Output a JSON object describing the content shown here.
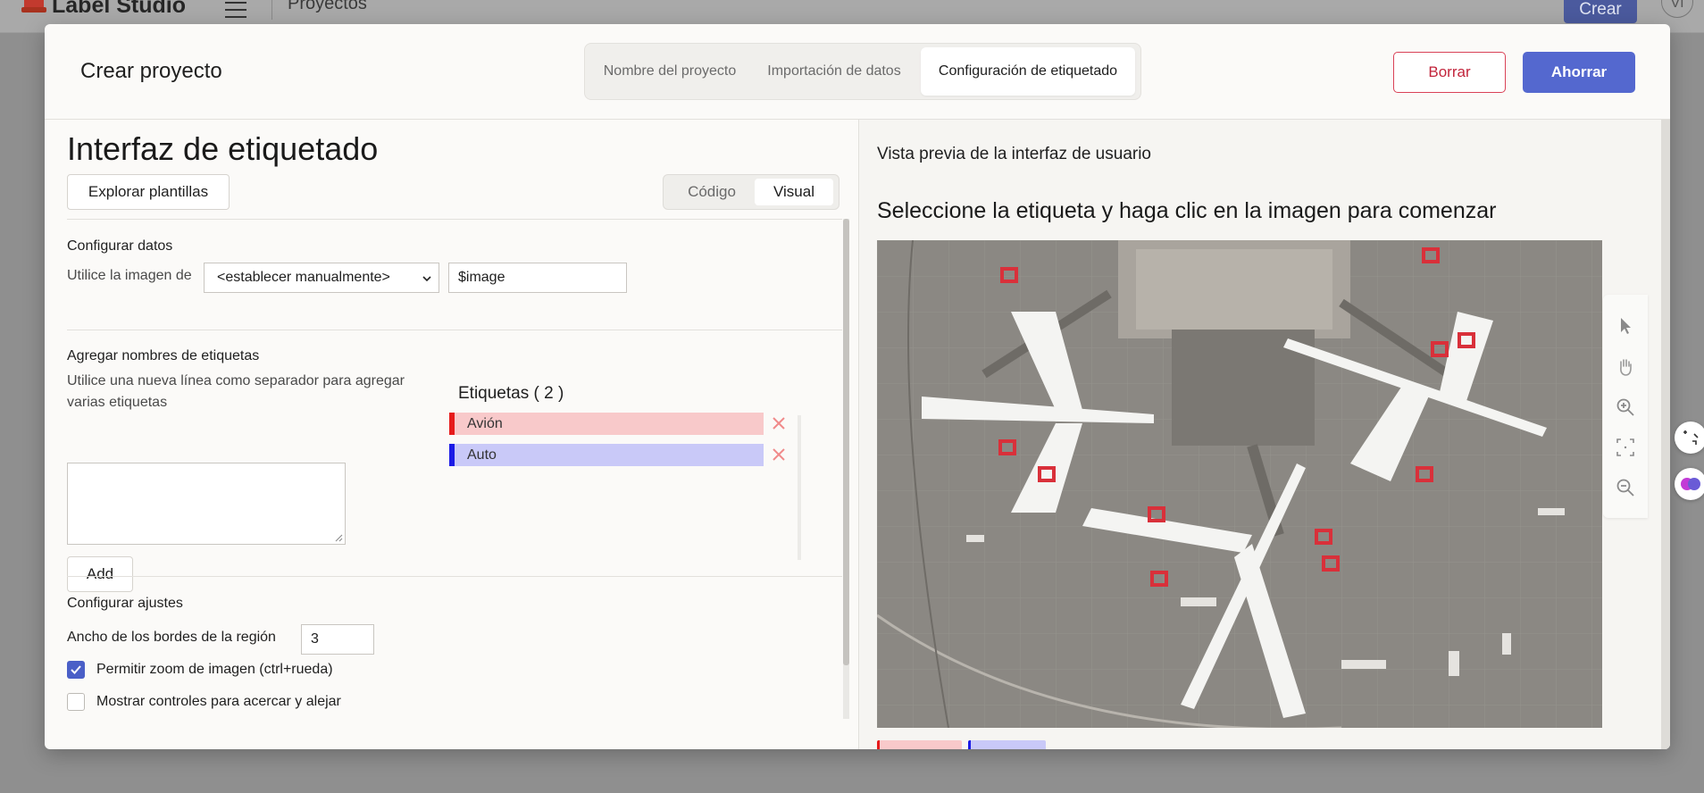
{
  "app": {
    "logo_text": "Label Studio",
    "breadcrumb": "Proyectos",
    "create_label": "Crear",
    "user_initials": "VI"
  },
  "modal": {
    "title": "Crear proyecto",
    "steps": [
      {
        "label": "Nombre del proyecto",
        "active": false
      },
      {
        "label": "Importación de datos",
        "active": false
      },
      {
        "label": "Configuración de etiquetado",
        "active": true
      }
    ],
    "delete_label": "Borrar",
    "save_label": "Ahorrar"
  },
  "config": {
    "heading": "Interfaz de etiquetado",
    "browse_templates_label": "Explorar plantillas",
    "view_modes": [
      "Código",
      "Visual"
    ],
    "active_view": "Visual",
    "data_section": {
      "title": "Configurar datos",
      "use_image_from": "Utilice la imagen de",
      "source_value": "<establecer manualmente>",
      "variable_value": "$image"
    },
    "labels_section": {
      "title": "Agregar nombres de etiquetas",
      "hint": "Utilice una nueva línea como separador para agregar varias etiquetas",
      "textarea_value": "",
      "add_label": "Add",
      "labels_heading": "Etiquetas ( 2 )",
      "labels": [
        {
          "name": "Avión",
          "color": "#e61b1b",
          "background": "#f8c9ca"
        },
        {
          "name": "Auto",
          "color": "#1b1be6",
          "background": "#c9c9f8"
        }
      ]
    },
    "settings_section": {
      "title": "Configurar ajustes",
      "stroke_width_label": "Ancho de los bordes de la región",
      "stroke_width_value": "3",
      "zoom_label": "Permitir zoom de imagen (ctrl+rueda)",
      "zoom_checked": true,
      "zoom_controls_label": "Mostrar controles para acercar y alejar",
      "zoom_controls_checked": false
    }
  },
  "preview": {
    "title": "Vista previa de la interfaz de usuario",
    "instruction": "Seleccione la etiqueta y haga clic en la imagen para comenzar",
    "image_subject": "Aerial view of airport apron with airplanes",
    "tools": [
      "pointer-icon",
      "pan-hand-icon",
      "zoom-in-icon",
      "fit-screen-icon",
      "zoom-out-icon"
    ]
  },
  "colors": {
    "primary": "#5468cf",
    "danger": "#c2243b",
    "label_red": "#e61b1b",
    "label_blue": "#1b1be6"
  }
}
